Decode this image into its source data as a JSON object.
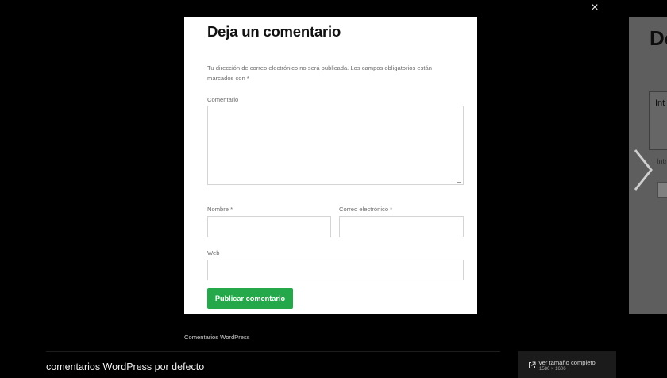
{
  "lightbox": {
    "close_glyph": "×",
    "caption": "Comentarios WordPress",
    "image_title": "comentarios WordPress por defecto",
    "full_size": {
      "label": "Ver tamaño completo",
      "dimensions": "1586 × 1606"
    }
  },
  "comment_form": {
    "title": "Deja un comentario",
    "notice": "Tu dirección de correo electrónico no será publicada. Los campos obligatorios están marcados con *",
    "comment_label": "Comentario",
    "name_label": "Nombre *",
    "email_label": "Correo electrónico *",
    "website_label": "Web",
    "submit_label": "Publicar comentario"
  },
  "next_slide": {
    "heading_fragment": "De",
    "box_text_fragment": "Int",
    "text_fragment": "Intr"
  },
  "colors": {
    "overlay": "#000000",
    "submit_button": "#24a84a",
    "panel": "#ffffff"
  }
}
